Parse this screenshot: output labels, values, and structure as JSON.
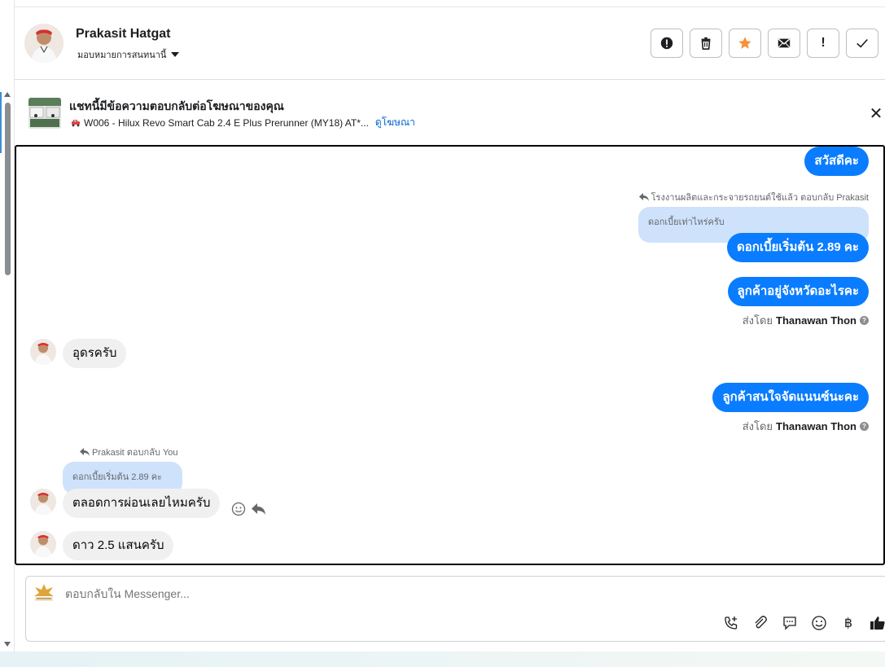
{
  "header": {
    "contact_name": "Prakasit Hatgat",
    "assign_label": "มอบหมายการสนทนานี้",
    "actions": [
      {
        "name": "report-spam-button",
        "icon": "alert-circle-icon"
      },
      {
        "name": "delete-button",
        "icon": "trash-icon"
      },
      {
        "name": "star-button",
        "icon": "star-icon"
      },
      {
        "name": "mark-unread-button",
        "icon": "envelope-icon"
      },
      {
        "name": "follow-up-button",
        "icon": "exclamation-icon",
        "label": "!"
      },
      {
        "name": "mark-done-button",
        "icon": "checkmark-icon"
      }
    ],
    "accent_star": "#f7923a"
  },
  "ad_banner": {
    "title": "แชทนี้มีข้อความตอบกลับต่อโฆษณาของคุณ",
    "subtitle": "W006 - Hilux Revo Smart Cab 2.4 E Plus Prerunner (MY18) AT*...",
    "link": "ดูโฆษณา"
  },
  "messages": {
    "m1": "สวัสดีคะ",
    "m2_reply_meta": "โรงงานผลิตและกระจายรถยนต์ใช้แล้ว ตอบกลับ Prakasit",
    "m2_quote": "ดอกเบี้ยเท่าไหร่ครับ",
    "m2": "ดอกเบี้ยเริ่มต้น 2.89 คะ",
    "m3": "ลูกค้าอยู่จังหวัดอะไรคะ",
    "m3_sent_prefix": "ส่งโดย",
    "m3_sent_name": "Thanawan Thon",
    "m4": "อุดรครับ",
    "m5": "ลูกค้าสนใจจัดแนนซ์นะคะ",
    "m5_sent_prefix": "ส่งโดย",
    "m5_sent_name": "Thanawan Thon",
    "m6_reply_meta": "Prakasit ตอบกลับ You",
    "m6_quote": "ดอกเบี้ยเริ่มต้น 2.89 คะ",
    "m6": "ตลอดการผ่อนเลยไหมครับ",
    "m7": "ดาว 2.5 แสนครับ"
  },
  "composer": {
    "placeholder": "ตอบกลับใน Messenger...",
    "tools": [
      "phone-plus-icon",
      "paperclip-icon",
      "chat-bubble-icon",
      "emoji-icon",
      "baht-icon",
      "thumbs-up-icon"
    ],
    "baht_label": "฿"
  },
  "colors": {
    "outgoing_bubble": "#0a7cff",
    "incoming_bubble": "#f0f0f0",
    "quote_bubble": "#cfe2fb",
    "link": "#0064d1"
  }
}
